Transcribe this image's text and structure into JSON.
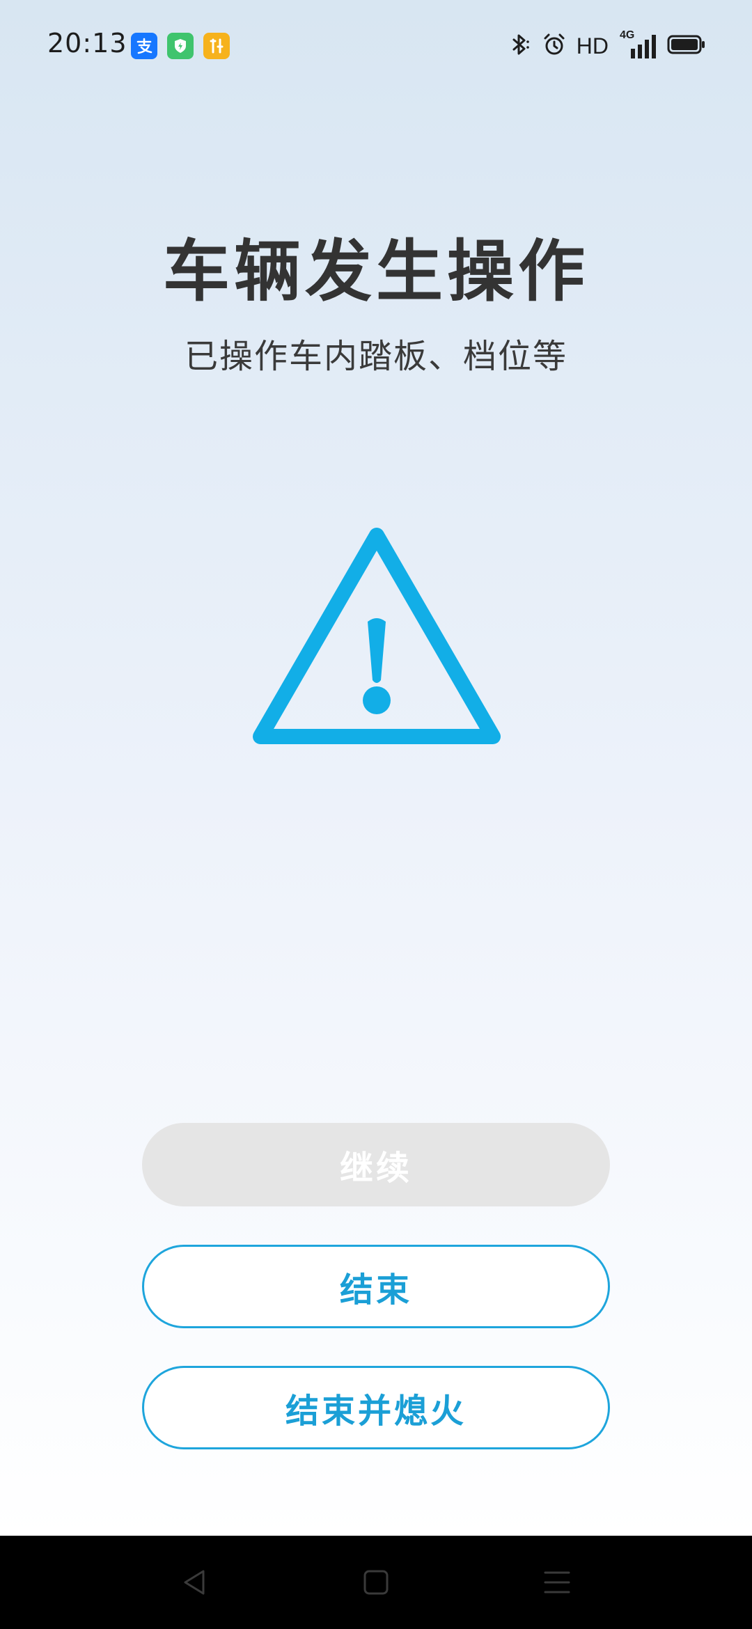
{
  "status_bar": {
    "time": "20:13",
    "network_label": "HD",
    "network_type": "4G",
    "icons": [
      "alipay-icon",
      "security-shield-icon",
      "tools-icon",
      "bluetooth-icon",
      "alarm-icon",
      "signal-icon",
      "battery-icon"
    ]
  },
  "main": {
    "title": "车辆发生操作",
    "subtitle": "已操作车内踏板、档位等",
    "icon": "warning-triangle-icon"
  },
  "buttons": {
    "continue_label": "继续",
    "end_label": "结束",
    "end_and_off_label": "结束并熄火"
  },
  "colors": {
    "accent": "#1ea5dc",
    "disabled_button": "#e5e5e5",
    "title_text": "#333333"
  },
  "nav_bar": {
    "icons": [
      "back-icon",
      "home-icon",
      "menu-icon"
    ]
  }
}
